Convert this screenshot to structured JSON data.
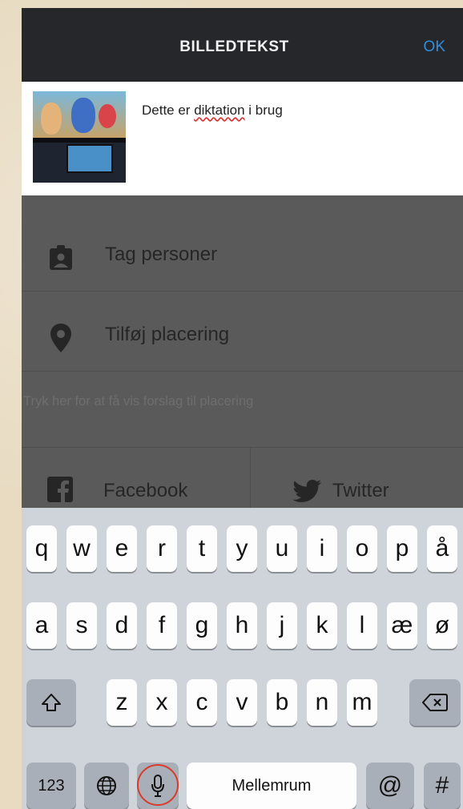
{
  "header": {
    "title": "BILLEDTEKST",
    "ok_label": "OK"
  },
  "caption": {
    "text_before": "Dette er ",
    "text_misspelled": "diktation",
    "text_after": " i brug",
    "thumbnail_alt": "photo thumbnail"
  },
  "form": {
    "tag_people_label": "Tag personer",
    "add_location_label": "Tilføj placering",
    "location_hint": "Tryk her for at få vis forslag til placering"
  },
  "share": {
    "facebook_label": "Facebook",
    "twitter_label": "Twitter"
  },
  "keyboard": {
    "row1": [
      "q",
      "w",
      "e",
      "r",
      "t",
      "y",
      "u",
      "i",
      "o",
      "p",
      "å"
    ],
    "row2": [
      "a",
      "s",
      "d",
      "f",
      "g",
      "h",
      "j",
      "k",
      "l",
      "æ",
      "ø"
    ],
    "row3": [
      "z",
      "x",
      "c",
      "v",
      "b",
      "n",
      "m"
    ],
    "numbers_label": "123",
    "space_label": "Mellemrum",
    "at_label": "@",
    "hash_label": "#"
  },
  "colors": {
    "header_bg": "#26272b",
    "accent": "#2f8ee0",
    "mic_highlight": "#d93a2b"
  }
}
